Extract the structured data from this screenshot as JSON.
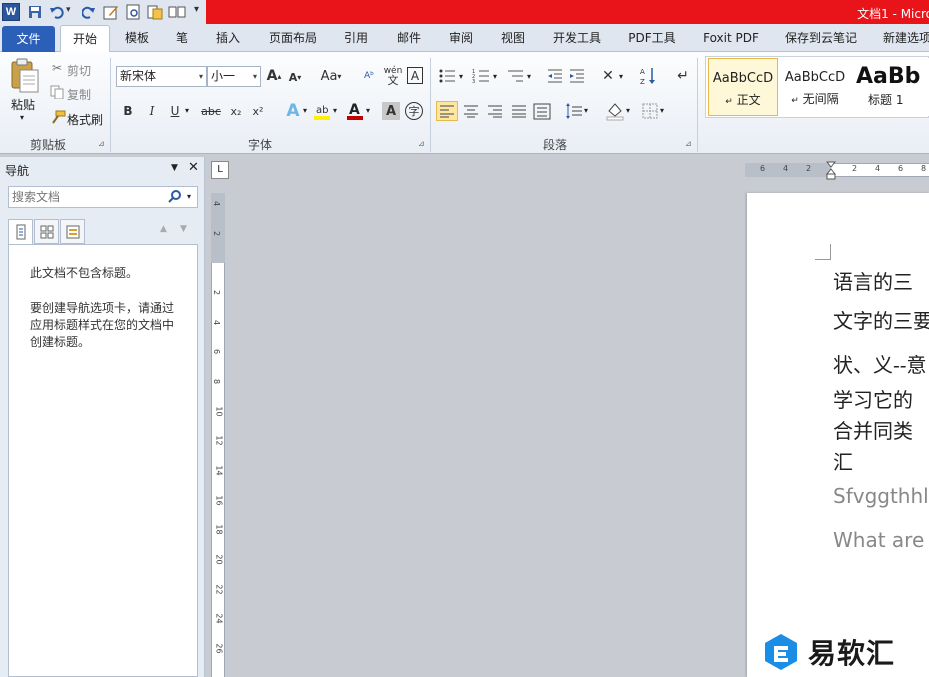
{
  "app": {
    "title": "文档1 - Micro"
  },
  "quick_access": {
    "menu_glyph": "▾"
  },
  "tabs": [
    "文件",
    "开始",
    "模板",
    "笔",
    "插入",
    "页面布局",
    "引用",
    "邮件",
    "审阅",
    "视图",
    "开发工具",
    "PDF工具",
    "Foxit PDF",
    "保存到云笔记",
    "新建选项"
  ],
  "ribbon": {
    "clipboard": {
      "paste": "粘贴",
      "cut": "剪切",
      "copy": "复制",
      "format_painter": "格式刷",
      "label": "剪贴板"
    },
    "font": {
      "font_name": "新宋体",
      "font_size": "小一",
      "label": "字体",
      "grow": "A",
      "shrink": "A",
      "case": "Aa",
      "bold": "B",
      "italic": "I",
      "underline": "U",
      "strike": "abc",
      "sub": "x₂",
      "sup": "x²",
      "color_a": "A",
      "shade_a": "A",
      "phonetic": "wén",
      "border_a": "A",
      "circle": "字"
    },
    "paragraph": {
      "label": "段落"
    },
    "styles": [
      {
        "sample": "AaBbCcD",
        "name": "正文",
        "mark": "↵"
      },
      {
        "sample": "AaBbCcD",
        "name": "无间隔",
        "mark": "↵"
      },
      {
        "sample": "AaBb",
        "name": "标题 1",
        "mark": ""
      }
    ]
  },
  "nav": {
    "title": "导航",
    "search_placeholder": "搜索文档",
    "msg1": "此文档不包含标题。",
    "msg2_l1": "要创建导航选项卡，请通过",
    "msg2_l2": "应用标题样式在您的文档中",
    "msg2_l3": "创建标题。"
  },
  "ruler": {
    "corner": "L",
    "h_numbers": [
      "6",
      "4",
      "2",
      "",
      "2",
      "4",
      "6",
      "8"
    ],
    "v_numbers": [
      "4",
      "2",
      "",
      "2",
      "4",
      "6",
      "8",
      "10",
      "12",
      "14",
      "16",
      "18",
      "20",
      "22",
      "24",
      "26"
    ]
  },
  "document": {
    "lines": [
      "语言的三",
      "文字的三要",
      "状、义--意",
      "学习它的",
      "合并同类",
      "汇"
    ],
    "en_lines": [
      "Sfvggthhl",
      "What are"
    ]
  },
  "watermark": {
    "text": "易软汇"
  },
  "colors": {
    "title_red": "#e8141a",
    "file_tab": "#2b5fb8",
    "accent_blue": "#1a8ee6"
  }
}
